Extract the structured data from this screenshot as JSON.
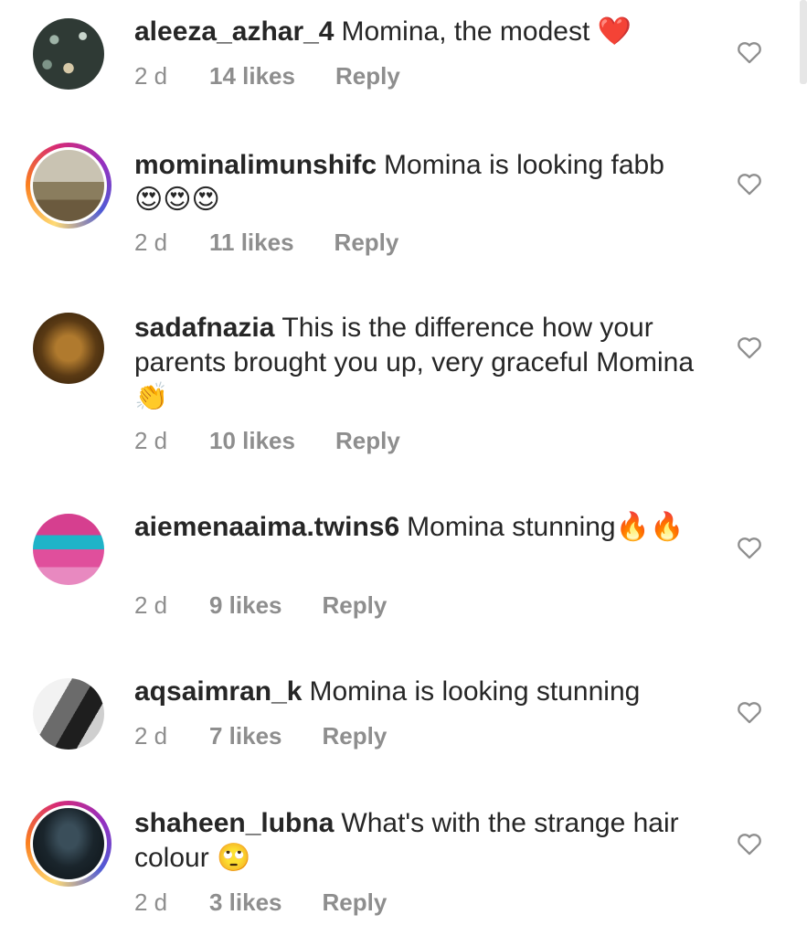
{
  "comments": [
    {
      "username": "aleeza_azhar_4",
      "text": "Momina, the modest",
      "emoji": "❤️",
      "time": "2 d",
      "likes": "14 likes",
      "reply": "Reply",
      "story_ring": false
    },
    {
      "username": "mominalimunshifc",
      "text": "Momina is looking fabb",
      "emoji": "😍😍😍",
      "time": "2 d",
      "likes": "11 likes",
      "reply": "Reply",
      "story_ring": true
    },
    {
      "username": "sadafnazia",
      "text": "This is the difference how your parents brought you up, very graceful Momina",
      "emoji": "👏",
      "time": "2 d",
      "likes": "10 likes",
      "reply": "Reply",
      "story_ring": false
    },
    {
      "username": "aiemenaaima.twins6",
      "text": "Momina stunning",
      "emoji": "🔥🔥",
      "time": "2 d",
      "likes": "9 likes",
      "reply": "Reply",
      "story_ring": false
    },
    {
      "username": "aqsaimran_k",
      "text": "Momina is looking stunning",
      "emoji": "",
      "time": "2 d",
      "likes": "7 likes",
      "reply": "Reply",
      "story_ring": false
    },
    {
      "username": "shaheen_lubna",
      "text": "What's with the strange hair colour",
      "emoji": "🙄",
      "time": "2 d",
      "likes": "3 likes",
      "reply": "Reply",
      "story_ring": true
    }
  ],
  "icons": {
    "like": "heart-outline-icon"
  }
}
